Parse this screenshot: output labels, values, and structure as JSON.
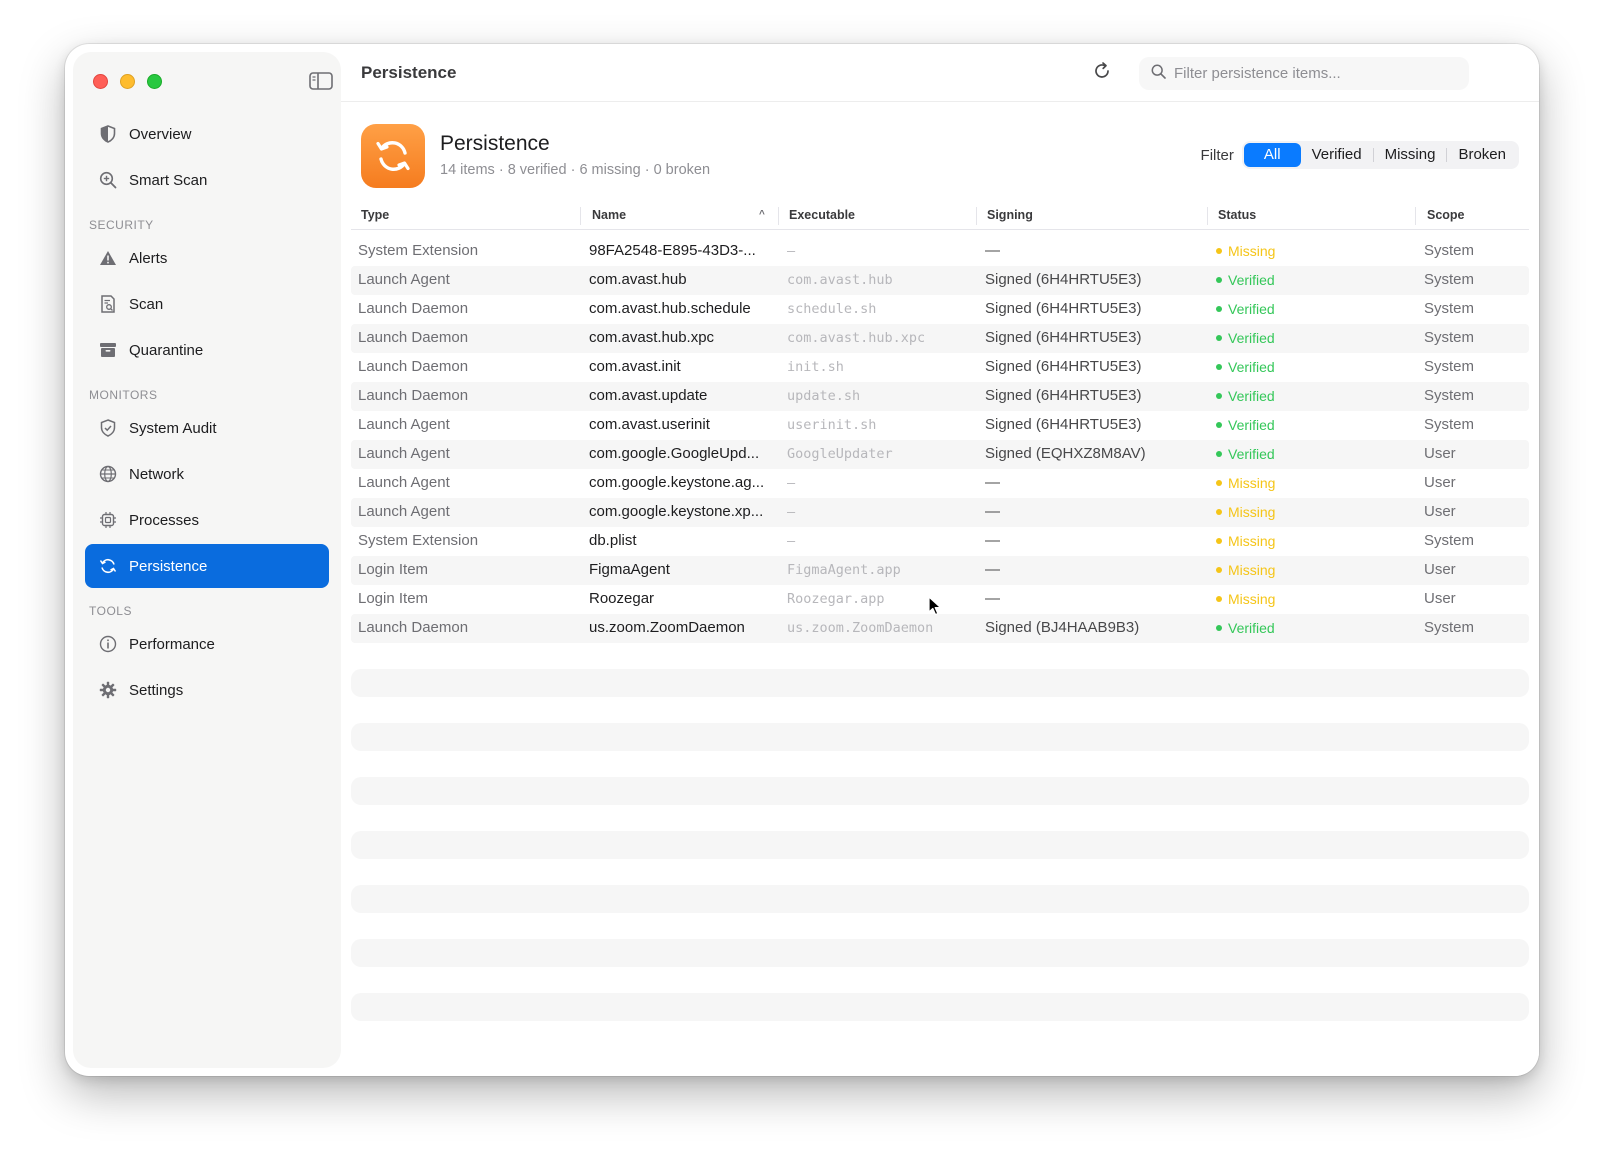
{
  "window": {
    "title": "Persistence"
  },
  "sidebar": {
    "toggle_icon": "sidebar-toggle-icon",
    "top_items": [
      {
        "label": "Overview",
        "icon": "shield-icon"
      },
      {
        "label": "Smart Scan",
        "icon": "magnifier-plus-icon"
      }
    ],
    "sections": [
      {
        "label": "SECURITY",
        "items": [
          {
            "label": "Alerts",
            "icon": "warning-icon"
          },
          {
            "label": "Scan",
            "icon": "document-search-icon"
          },
          {
            "label": "Quarantine",
            "icon": "archive-box-icon"
          }
        ]
      },
      {
        "label": "MONITORS",
        "items": [
          {
            "label": "System Audit",
            "icon": "shield-check-icon"
          },
          {
            "label": "Network",
            "icon": "globe-icon"
          },
          {
            "label": "Processes",
            "icon": "cpu-icon"
          },
          {
            "label": "Persistence",
            "icon": "sync-icon",
            "active": true
          }
        ]
      },
      {
        "label": "TOOLS",
        "items": [
          {
            "label": "Performance",
            "icon": "info-circle-icon"
          },
          {
            "label": "Settings",
            "icon": "gear-icon"
          }
        ]
      }
    ]
  },
  "toolbar": {
    "title": "Persistence",
    "refresh_icon": "refresh-icon",
    "search": {
      "placeholder": "Filter persistence items...",
      "value": ""
    }
  },
  "header": {
    "title": "Persistence",
    "stats": {
      "items": "14 items",
      "verified": "8 verified",
      "missing": "6 missing",
      "broken": "0 broken",
      "separator": " · "
    },
    "filter": {
      "label": "Filter",
      "options": [
        "All",
        "Verified",
        "Missing",
        "Broken"
      ],
      "selected": "All"
    }
  },
  "colors": {
    "accent": "#0a6cde",
    "segment_active": "#0a7bff",
    "verified": "#34c759",
    "missing": "#f5c518",
    "app_icon": "#f78a2c"
  },
  "table": {
    "columns": [
      "Type",
      "Name",
      "Executable",
      "Signing",
      "Status",
      "Scope"
    ],
    "sorted_column": "Name",
    "rows": [
      {
        "type": "System Extension",
        "name": "98FA2548-E895-43D3-...",
        "executable": "—",
        "signing": "—",
        "status": "Missing",
        "scope": "System"
      },
      {
        "type": "Launch Agent",
        "name": "com.avast.hub",
        "executable": "com.avast.hub",
        "signing": "Signed (6H4HRTU5E3)",
        "status": "Verified",
        "scope": "System"
      },
      {
        "type": "Launch Daemon",
        "name": "com.avast.hub.schedule",
        "executable": "schedule.sh",
        "signing": "Signed (6H4HRTU5E3)",
        "status": "Verified",
        "scope": "System"
      },
      {
        "type": "Launch Daemon",
        "name": "com.avast.hub.xpc",
        "executable": "com.avast.hub.xpc",
        "signing": "Signed (6H4HRTU5E3)",
        "status": "Verified",
        "scope": "System"
      },
      {
        "type": "Launch Daemon",
        "name": "com.avast.init",
        "executable": "init.sh",
        "signing": "Signed (6H4HRTU5E3)",
        "status": "Verified",
        "scope": "System"
      },
      {
        "type": "Launch Daemon",
        "name": "com.avast.update",
        "executable": "update.sh",
        "signing": "Signed (6H4HRTU5E3)",
        "status": "Verified",
        "scope": "System"
      },
      {
        "type": "Launch Agent",
        "name": "com.avast.userinit",
        "executable": "userinit.sh",
        "signing": "Signed (6H4HRTU5E3)",
        "status": "Verified",
        "scope": "System"
      },
      {
        "type": "Launch Agent",
        "name": "com.google.GoogleUpd...",
        "executable": "GoogleUpdater",
        "signing": "Signed (EQHXZ8M8AV)",
        "status": "Verified",
        "scope": "User"
      },
      {
        "type": "Launch Agent",
        "name": "com.google.keystone.ag...",
        "executable": "—",
        "signing": "—",
        "status": "Missing",
        "scope": "User"
      },
      {
        "type": "Launch Agent",
        "name": "com.google.keystone.xp...",
        "executable": "—",
        "signing": "—",
        "status": "Missing",
        "scope": "User"
      },
      {
        "type": "System Extension",
        "name": "db.plist",
        "executable": "—",
        "signing": "—",
        "status": "Missing",
        "scope": "System"
      },
      {
        "type": "Login Item",
        "name": "FigmaAgent",
        "executable": "FigmaAgent.app",
        "signing": "—",
        "status": "Missing",
        "scope": "User"
      },
      {
        "type": "Login Item",
        "name": "Roozegar",
        "executable": "Roozegar.app",
        "signing": "—",
        "status": "Missing",
        "scope": "User"
      },
      {
        "type": "Launch Daemon",
        "name": "us.zoom.ZoomDaemon",
        "executable": "us.zoom.ZoomDaemon",
        "signing": "Signed (BJ4HAAB9B3)",
        "status": "Verified",
        "scope": "System"
      }
    ]
  }
}
